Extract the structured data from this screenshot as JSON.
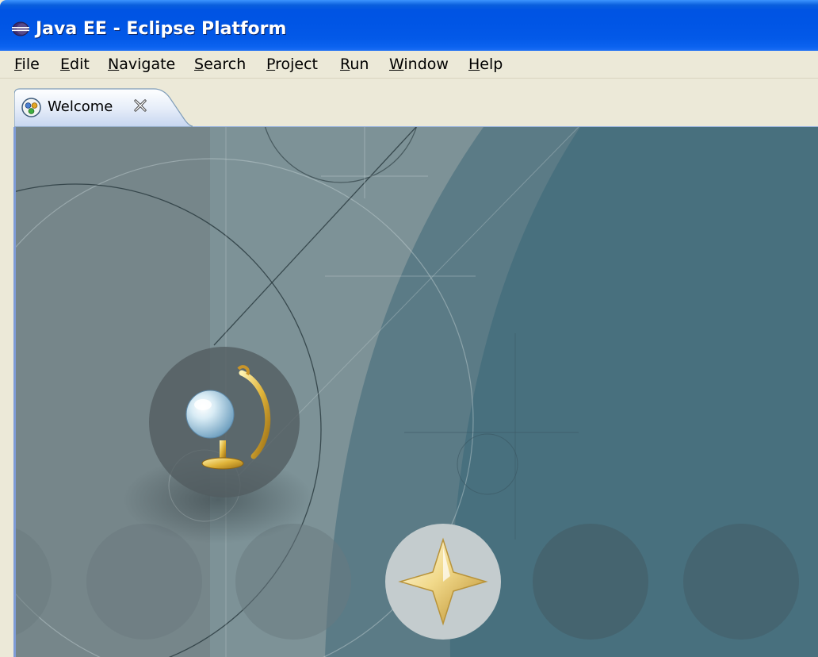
{
  "window": {
    "title": "Java EE - Eclipse Platform",
    "app_icon": "eclipse-icon"
  },
  "menubar": {
    "items": [
      {
        "label": "File"
      },
      {
        "label": "Edit"
      },
      {
        "label": "Navigate"
      },
      {
        "label": "Search"
      },
      {
        "label": "Project"
      },
      {
        "label": "Run"
      },
      {
        "label": "Window"
      },
      {
        "label": "Help"
      }
    ]
  },
  "tabs": [
    {
      "label": "Welcome",
      "icon": "welcome-icon",
      "close_icon": "close-icon",
      "active": true
    }
  ],
  "welcome_page": {
    "nav_icons": [
      {
        "name": "overview-globe-icon",
        "highlighted": true
      },
      {
        "name": "workbench-star-icon",
        "highlighted": true
      }
    ]
  }
}
